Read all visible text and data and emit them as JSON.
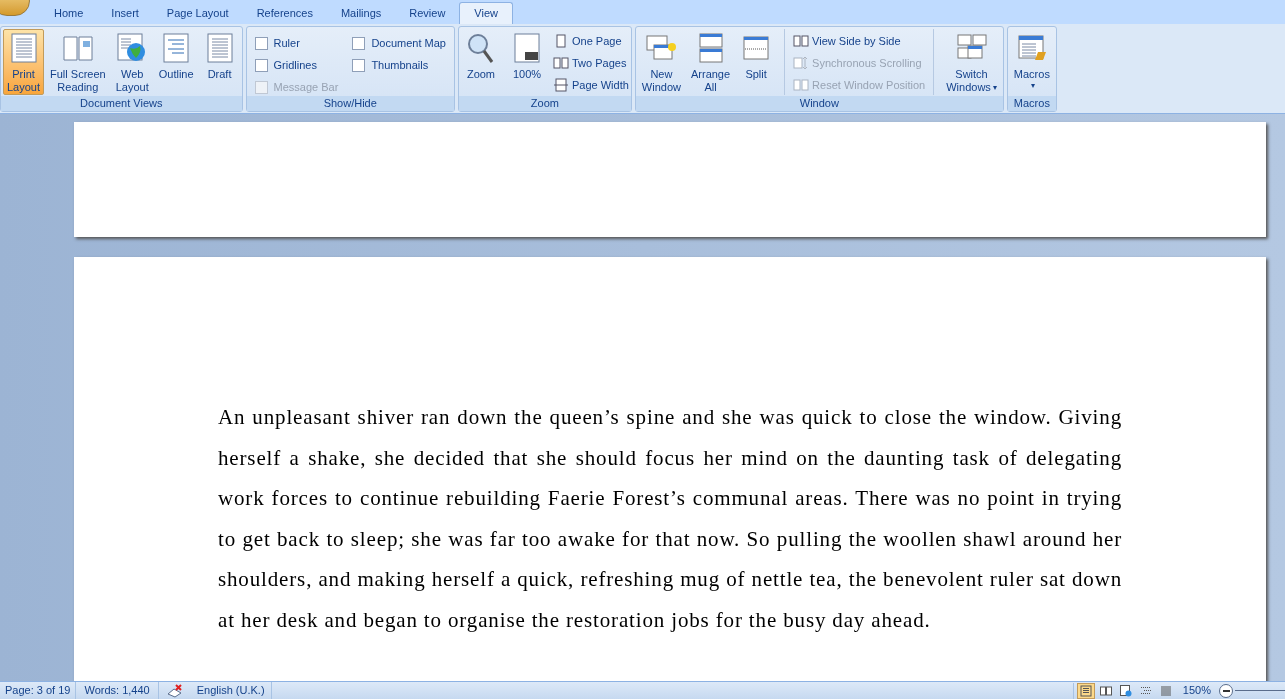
{
  "tabs": [
    {
      "label": "Home",
      "selected": false
    },
    {
      "label": "Insert",
      "selected": false
    },
    {
      "label": "Page Layout",
      "selected": false
    },
    {
      "label": "References",
      "selected": false
    },
    {
      "label": "Mailings",
      "selected": false
    },
    {
      "label": "Review",
      "selected": false
    },
    {
      "label": "View",
      "selected": true
    }
  ],
  "groups": [
    {
      "title": "Document Views",
      "kind": "views",
      "items": [
        {
          "kind": "print",
          "lines": [
            "Print",
            "Layout"
          ],
          "selected": true
        },
        {
          "kind": "fullscreen",
          "lines": [
            "Full Screen",
            "Reading"
          ],
          "selected": false
        },
        {
          "kind": "web",
          "lines": [
            "Web",
            "Layout"
          ],
          "selected": false
        },
        {
          "kind": "outline",
          "lines": [
            "Outline"
          ],
          "selected": false
        },
        {
          "kind": "draft",
          "lines": [
            "Draft"
          ],
          "selected": false
        }
      ]
    },
    {
      "title": "Show/Hide",
      "kind": "checks",
      "items": [
        {
          "label": "Ruler",
          "checked": false,
          "disabled": false
        },
        {
          "label": "Gridlines",
          "checked": false,
          "disabled": false
        },
        {
          "label": "Message Bar",
          "checked": false,
          "disabled": true
        },
        {
          "label": "Document Map",
          "checked": false,
          "disabled": false
        },
        {
          "label": "Thumbnails",
          "checked": false,
          "disabled": false
        }
      ]
    },
    {
      "title": "Zoom",
      "kind": "zoom",
      "items": [
        {
          "kind": "zoom",
          "lines": [
            "Zoom"
          ]
        },
        {
          "kind": "hundred",
          "lines": [
            "100%"
          ]
        }
      ],
      "small": [
        {
          "kind": "onepage",
          "label": "One Page",
          "disabled": false
        },
        {
          "kind": "twopages",
          "label": "Two Pages",
          "disabled": false
        },
        {
          "kind": "pagewidth",
          "label": "Page Width",
          "disabled": false
        }
      ]
    },
    {
      "title": "Window",
      "kind": "window",
      "items": [
        {
          "kind": "newwindow",
          "lines": [
            "New",
            "Window"
          ]
        },
        {
          "kind": "arrange",
          "lines": [
            "Arrange",
            "All"
          ]
        },
        {
          "kind": "split",
          "lines": [
            "Split"
          ]
        }
      ],
      "small": [
        {
          "kind": "sidebyside",
          "label": "View Side by Side",
          "disabled": false
        },
        {
          "kind": "sync",
          "label": "Synchronous Scrolling",
          "disabled": true
        },
        {
          "kind": "reset",
          "label": "Reset Window Position",
          "disabled": true
        }
      ],
      "after": [
        {
          "kind": "switch",
          "lines": [
            "Switch",
            "Windows"
          ],
          "dropdown": "▾"
        }
      ]
    },
    {
      "title": "Macros",
      "kind": "macros",
      "items": [
        {
          "kind": "macros",
          "lines": [
            "Macros"
          ],
          "dropdown": "▾"
        }
      ]
    }
  ],
  "paragraph": "An unpleasant shiver ran down the queen’s spine and she was quick to close the window. Giving herself a shake, she decided that she should focus her mind on the daunting task of delegating work forces to continue rebuilding Faerie Forest’s communal areas. There was no point in trying to get back to sleep; she was far too awake for that now. So pulling the woollen shawl around her shoulders, and making herself a quick, refreshing mug of nettle tea, the benevolent ruler sat down at her desk and began to organise the restoration jobs for the busy day ahead.",
  "status_bar": {
    "page": "Page: 3 of 19",
    "words": "Words: 1,440",
    "language": "English (U.K.)",
    "views": [
      {
        "kind": "print",
        "selected": true
      },
      {
        "kind": "fullscreen",
        "selected": false
      },
      {
        "kind": "web",
        "selected": false
      },
      {
        "kind": "outline",
        "selected": false
      },
      {
        "kind": "draft",
        "selected": false
      }
    ],
    "zoom": "150%"
  }
}
